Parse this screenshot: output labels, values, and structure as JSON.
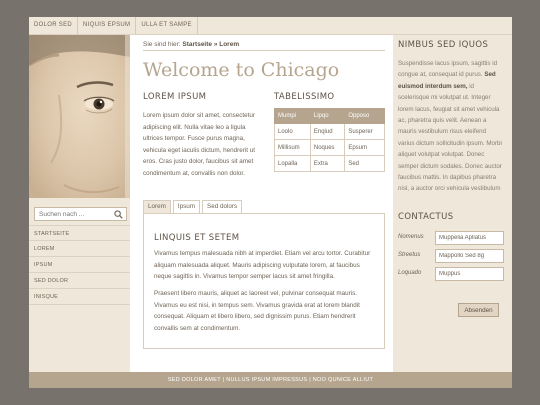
{
  "topnav": {
    "items": [
      "DOLOR SED",
      "NIQUIS EPSUM",
      "ULLA ET SAMPE"
    ]
  },
  "sidebar": {
    "search_placeholder": "Suchen nach ...",
    "items": [
      "STARTSEITE",
      "LOREM",
      "IPSUM",
      "SED DOLOR",
      "INISQUE"
    ]
  },
  "breadcrumb": {
    "prefix": "Sie sind hier:",
    "path": "Startseite » Lorem"
  },
  "main": {
    "title": "Welcome to Chicago",
    "lorem_heading": "LOREM IPSUM",
    "lorem_text": "Lorem ipsum dolor sit amet, consectetur adipiscing elit. Nulla vitae leo a ligula ultrices tempor. Fusce purus magna, vehicula eget iaculis dictum, hendrerit ut eros. Cras justo dolor, faucibus sit amet condimentum at, convallis non dolor.",
    "table_heading": "TABELISSIMO",
    "table": {
      "headers": [
        "Mumpi",
        "Lipqo",
        "Opposo"
      ],
      "rows": [
        [
          "Loolo",
          "Enqiud",
          "Susperer"
        ],
        [
          "Millisum",
          "Noques",
          "Epsum"
        ],
        [
          "Lopalla",
          "Extra",
          "Sed"
        ]
      ]
    },
    "tabs": [
      "Lorem",
      "Ipsum",
      "Sed dolors"
    ],
    "box_heading": "LINQUIS ET SETEM",
    "box_text_1": "Vivamus tempus malesuada nibh at imperdiet. Etiam vel arcu tortor. Curabitur aliquam malesuada aliquet. Mauris adipiscing vulputate lorem, at faucibus neque sagittis in. Vivamus tempor semper lacus sit amet fringilla.",
    "box_text_2": "Praesent libero mauris, aliquet ac laoreet vel, pulvinar consequat mauris. Vivamus eu est nisi, in tempus sem. Vivamus gravida erat at lorem blandit consequat. Aliquam et libero libero, sed dignissim purus. Etiam hendrerit convallis sem at condimentum."
  },
  "right": {
    "nimbus_heading": "NIMBUS SED IQUOS",
    "nimbus_text_1": "Suspendisse lacus ipsum, sagittis id congue at, consequat id purus.",
    "nimbus_bold": "Sed euismod interdum sem,",
    "nimbus_text_2": "id scelerisque mi volutpat ut. Integer lorem lacus, feugiat sit amet vehicula ac, pharetra quis velit. Aenean a mauris vestibulum risus eleifend varius dictum sollicitudin ipsum. Morbi aliquet volutpat volutpat. Donec semper dictum sodales. Donec auctor faucibus mattis. In dapibus pharetra nisl, a auctor orci vehicula vestibulum",
    "contact_heading": "CONTACTUS",
    "fields": [
      {
        "label": "Nomenus",
        "value": "Muppelia Apllatus"
      },
      {
        "label": "Streetus",
        "value": "Mappollo Sed 8g"
      },
      {
        "label": "Loquado",
        "value": "Muppus"
      }
    ],
    "send_label": "Absenden"
  },
  "footer": {
    "text": "SED DOLOR AMET | NULLUS IPSUM IMPRESSUS | NOO QUNICE ALLIUT"
  },
  "colors": {
    "background": "#77726b",
    "panel": "#efe7da",
    "accent": "#b5a58f",
    "heading": "#5d5246",
    "text": "#6f6457"
  },
  "icons": {
    "search": "search-icon"
  }
}
